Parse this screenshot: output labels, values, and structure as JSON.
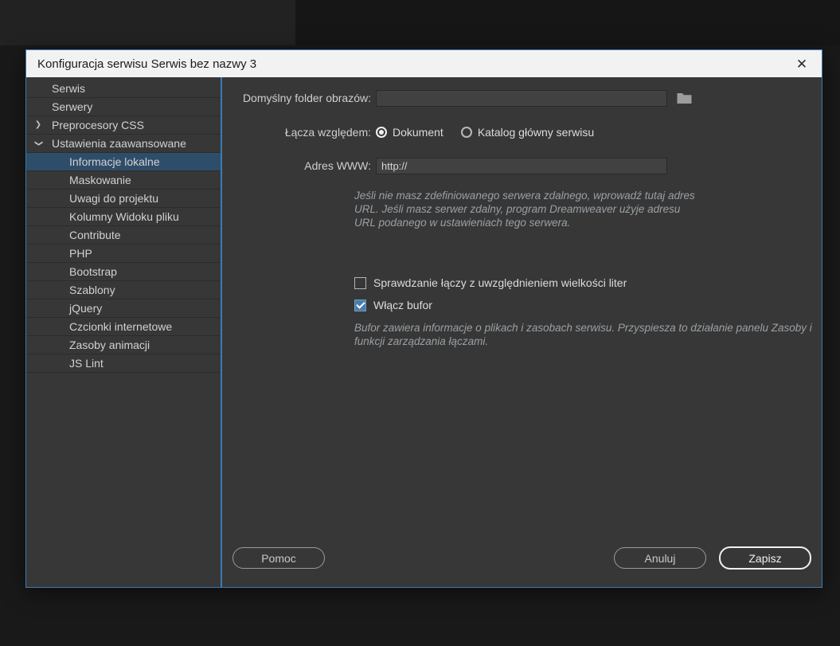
{
  "dialog": {
    "title": "Konfiguracja serwisu Serwis bez nazwy 3",
    "close_glyph": "✕"
  },
  "icons": {
    "chevron_glyph": "❯",
    "folder": "folder-icon"
  },
  "colors": {
    "accent_border": "#3d7ab2",
    "selected_row": "#2e4d69",
    "titlebar": "#f2f2f2",
    "dialog_bg": "#373737"
  },
  "sidebar": {
    "items": [
      {
        "label": "Serwis",
        "level": 1,
        "chevron": "none",
        "selected": false
      },
      {
        "label": "Serwery",
        "level": 1,
        "chevron": "none",
        "selected": false
      },
      {
        "label": "Preprocesory CSS",
        "level": 1,
        "chevron": "collapsed",
        "selected": false
      },
      {
        "label": "Ustawienia zaawansowane",
        "level": 1,
        "chevron": "expanded",
        "selected": false
      },
      {
        "label": "Informacje lokalne",
        "level": 2,
        "chevron": "none",
        "selected": true
      },
      {
        "label": "Maskowanie",
        "level": 2,
        "chevron": "none",
        "selected": false
      },
      {
        "label": "Uwagi do projektu",
        "level": 2,
        "chevron": "none",
        "selected": false
      },
      {
        "label": "Kolumny Widoku pliku",
        "level": 2,
        "chevron": "none",
        "selected": false
      },
      {
        "label": "Contribute",
        "level": 2,
        "chevron": "none",
        "selected": false
      },
      {
        "label": "PHP",
        "level": 2,
        "chevron": "none",
        "selected": false
      },
      {
        "label": "Bootstrap",
        "level": 2,
        "chevron": "none",
        "selected": false
      },
      {
        "label": "Szablony",
        "level": 2,
        "chevron": "none",
        "selected": false
      },
      {
        "label": "jQuery",
        "level": 2,
        "chevron": "none",
        "selected": false
      },
      {
        "label": "Czcionki internetowe",
        "level": 2,
        "chevron": "none",
        "selected": false
      },
      {
        "label": "Zasoby animacji",
        "level": 2,
        "chevron": "none",
        "selected": false
      },
      {
        "label": "JS Lint",
        "level": 2,
        "chevron": "none",
        "selected": false
      }
    ]
  },
  "form": {
    "default_images_label": "Domyślny folder obrazów:",
    "default_images_value": "",
    "links_relative_label": "Łącza względem:",
    "radio_document_label": "Dokument",
    "radio_document_checked": true,
    "radio_site_root_label": "Katalog główny serwisu",
    "radio_site_root_checked": false,
    "web_address_label": "Adres WWW:",
    "web_address_value": "http://",
    "web_address_hint": "Jeśli nie masz zdefiniowanego serwera zdalnego, wprowadź tutaj adres URL. Jeśli masz serwer zdalny, program Dreamweaver użyje adresu URL podanego w ustawieniach tego serwera.",
    "checkbox_case_label": "Sprawdzanie łączy z uwzględnieniem wielkości liter",
    "checkbox_case_checked": false,
    "checkbox_cache_label": "Włącz bufor",
    "checkbox_cache_checked": true,
    "cache_hint": "Bufor zawiera informacje o plikach i zasobach serwisu. Przyspiesza to działanie panelu Zasoby i funkcji zarządzania łączami."
  },
  "buttons": {
    "help": "Pomoc",
    "cancel": "Anuluj",
    "save": "Zapisz"
  }
}
